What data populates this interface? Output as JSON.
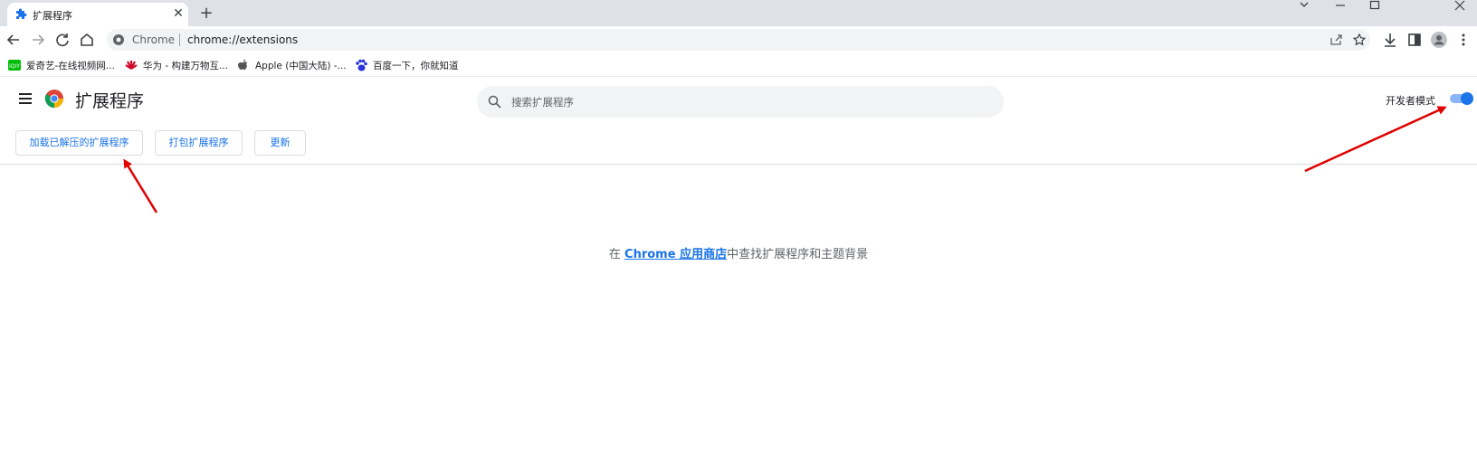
{
  "browser": {
    "tab": {
      "title": "扩展程序",
      "icon": "puzzle-icon"
    },
    "new_tab_icon": "plus-icon",
    "window_controls": [
      "chevron-down-icon",
      "minimize-icon",
      "maximize-icon",
      "close-icon"
    ]
  },
  "toolbar": {
    "omnibox": {
      "chip": "Chrome",
      "url": "chrome://extensions"
    },
    "icons": [
      "share-icon",
      "star-icon",
      "download-icon",
      "side-panel-icon",
      "profile-icon",
      "more-icon"
    ]
  },
  "bookmarks": [
    {
      "label": "爱奇艺-在线视频网...",
      "icon": "iqiyi-icon"
    },
    {
      "label": "华为 - 构建万物互...",
      "icon": "huawei-icon"
    },
    {
      "label": "Apple (中国大陆) -...",
      "icon": "apple-icon"
    },
    {
      "label": "百度一下，你就知道",
      "icon": "baidu-icon"
    }
  ],
  "extensions": {
    "title": "扩展程序",
    "search_placeholder": "搜索扩展程序",
    "dev_mode_label": "开发者模式",
    "dev_mode_on": true,
    "actions": {
      "load_unpacked": "加载已解压的扩展程序",
      "pack": "打包扩展程序",
      "update": "更新"
    },
    "empty": {
      "prefix": "在 ",
      "link": "Chrome 应用商店",
      "suffix": "中查找扩展程序和主题背景"
    }
  },
  "colors": {
    "accent": "#1a73e8",
    "arrow": "#e00000",
    "tabstrip": "#dee1e6"
  }
}
